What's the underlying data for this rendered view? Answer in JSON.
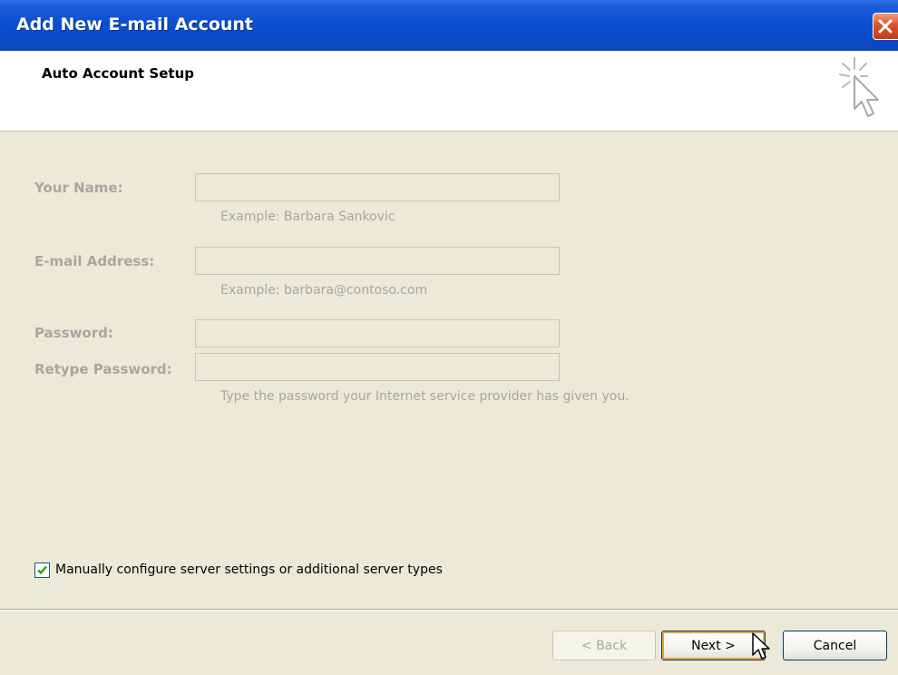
{
  "window": {
    "title": "Add New E-mail Account"
  },
  "header": {
    "title": "Auto Account Setup"
  },
  "form": {
    "name": {
      "label": "Your Name:",
      "value": "",
      "hint": "Example: Barbara Sankovic"
    },
    "email": {
      "label": "E-mail Address:",
      "value": "",
      "hint": "Example: barbara@contoso.com"
    },
    "password": {
      "label": "Password:",
      "value": ""
    },
    "retype_password": {
      "label": "Retype Password:",
      "value": "",
      "hint": "Type the password your Internet service provider has given you."
    }
  },
  "manual_config": {
    "label": "Manually configure server settings or additional server types",
    "checked": true
  },
  "buttons": {
    "back": "< Back",
    "next": "Next >",
    "cancel": "Cancel"
  },
  "colors": {
    "titlebar": "#0A4AC9",
    "dialog_bg": "#ECE9D8",
    "disabled_text": "#A7A7A0",
    "close": "#D8532E"
  }
}
